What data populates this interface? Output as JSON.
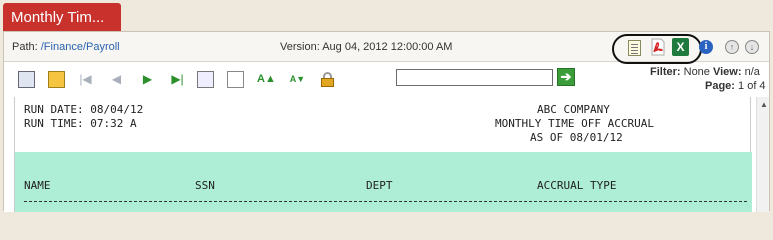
{
  "tab": {
    "title": "Monthly Tim..."
  },
  "pathbar": {
    "path_label": "Path: ",
    "path_value": "/Finance/Payroll",
    "version_label": "Version: ",
    "version_value": "Aug 04, 2012 12:00:00 AM"
  },
  "export_icons": [
    "text-export-icon",
    "pdf-export-icon",
    "excel-export-icon"
  ],
  "excel_glyph": "X",
  "info_glyph": "i",
  "nav_glyphs": {
    "up": "↑",
    "down": "↓"
  },
  "toolbar": {
    "icons": [
      "report-view-icon",
      "sticky-note-icon",
      "first-page-icon",
      "previous-page-icon",
      "next-page-icon",
      "last-page-icon",
      "print-icon",
      "document-icon",
      "increase-font-icon",
      "decrease-font-icon",
      "lock-icon"
    ],
    "glyphs": {
      "first": "|◀",
      "prev": "◀",
      "next": "▶",
      "last": "▶|",
      "increase": "A▲",
      "decrease": "A▼"
    },
    "search_value": "",
    "go_glyph": "➔"
  },
  "status": {
    "filter_label": "Filter:",
    "filter_value": "None",
    "view_label": "View:",
    "view_value": "n/a",
    "page_label": "Page:",
    "page_value": "1 of 4"
  },
  "report": {
    "run_date": "RUN DATE: 08/04/12",
    "run_time": "RUN TIME: 07:32 A",
    "company": "ABC COMPANY",
    "report_title": "MONTHLY TIME OFF ACCRUAL",
    "as_of": "AS OF 08/01/12",
    "columns": [
      "NAME",
      "SSN",
      "DEPT",
      "ACCRUAL TYPE"
    ]
  },
  "colors": {
    "tab_red": "#c8312c",
    "band_green": "#aeeed6",
    "link_blue": "#2a62b0"
  }
}
